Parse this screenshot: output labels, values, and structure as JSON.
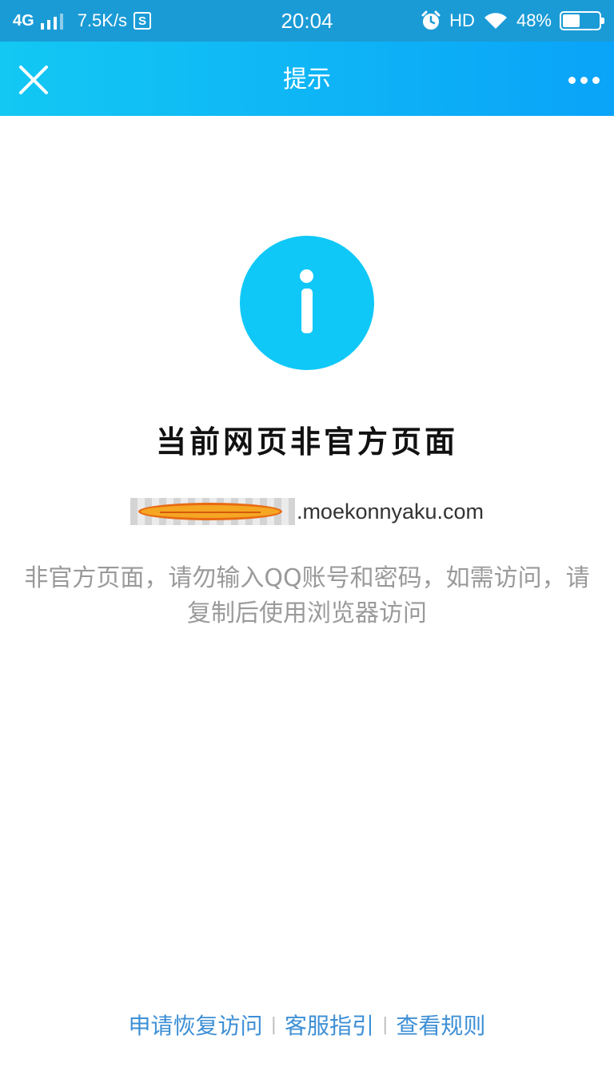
{
  "status_bar": {
    "network": "4G",
    "speed": "7.5K/s",
    "s_icon_text": "S",
    "time": "20:04",
    "hd": "HD",
    "battery": "48%",
    "battery_level": 0.48
  },
  "navbar": {
    "title": "提示"
  },
  "content": {
    "title": "当前网页非官方页面",
    "url_suffix": ".moekonnyaku.com",
    "description": "非官方页面，请勿输入QQ账号和密码，如需访问，请复制后使用浏览器访问"
  },
  "footer": {
    "links": [
      "申请恢复访问",
      "客服指引",
      "查看规则"
    ],
    "separator": "|"
  },
  "colors": {
    "navbar_start": "#13c8f3",
    "navbar_end": "#0aa3f8",
    "info_circle": "#0fc8f7",
    "link": "#3d8fd6",
    "description": "#9a9a9a"
  }
}
